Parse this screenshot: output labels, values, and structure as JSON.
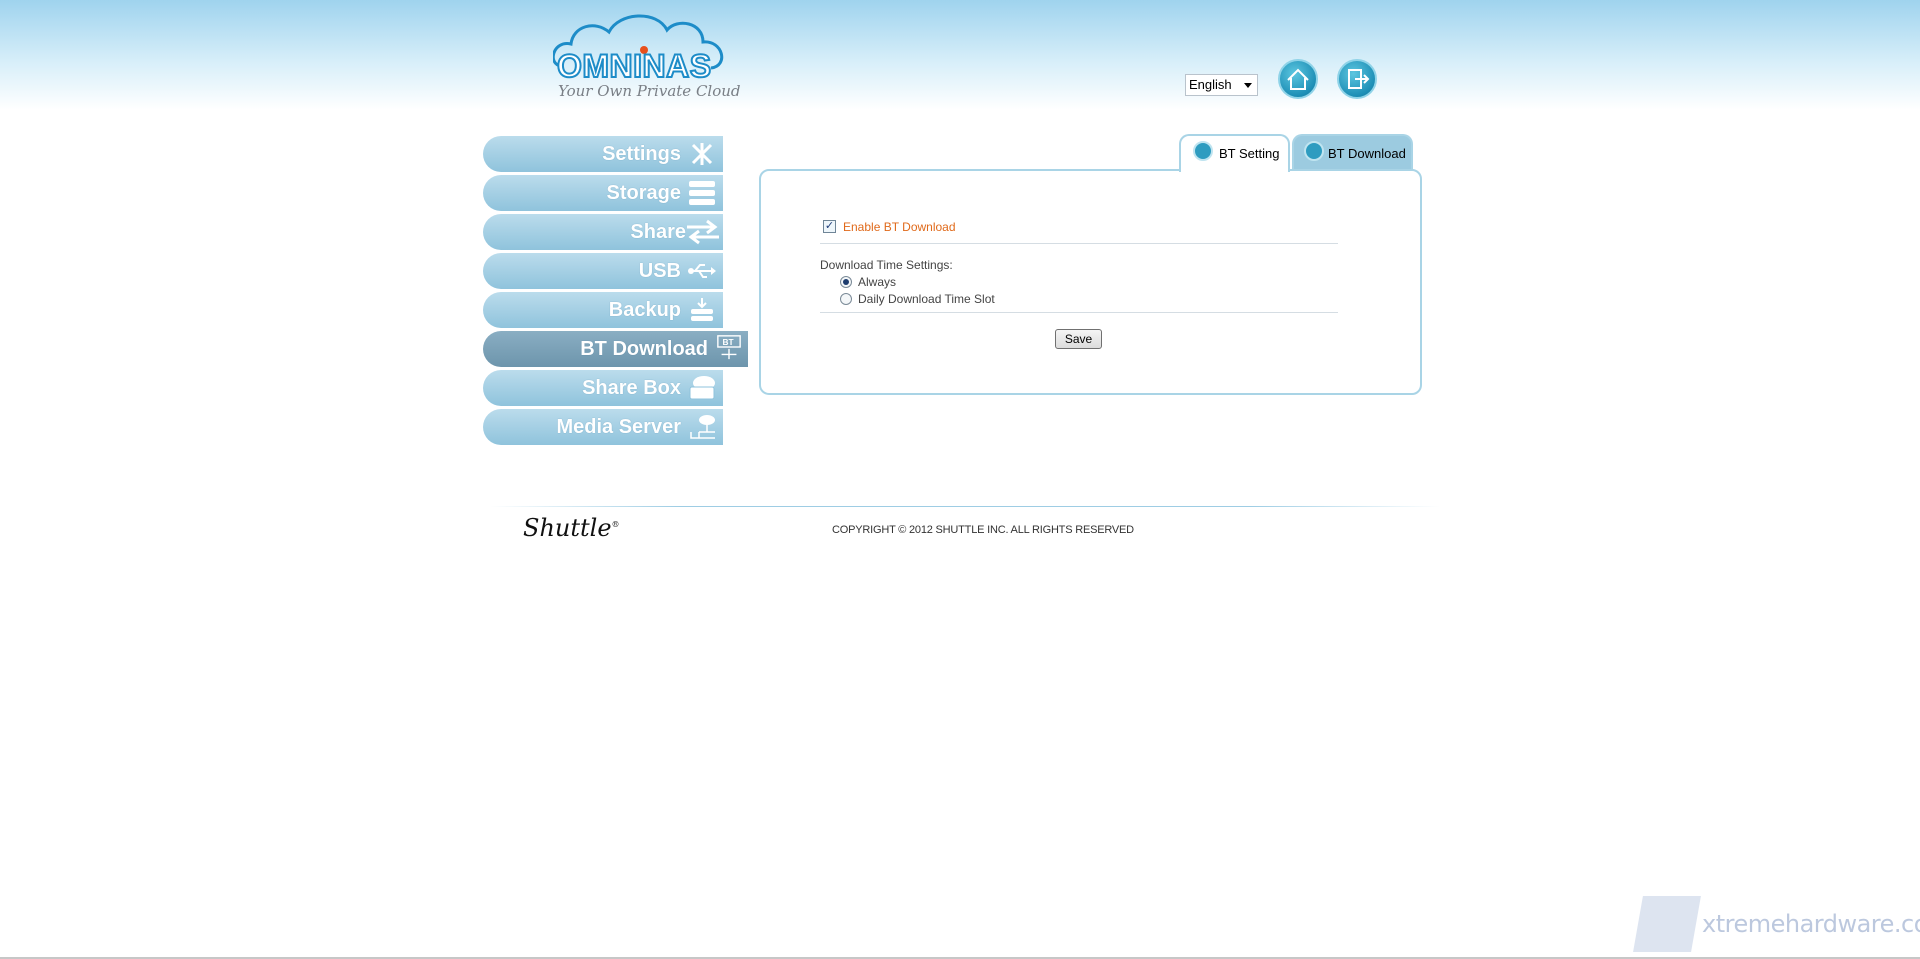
{
  "header": {
    "logo_name": "OMNINAS",
    "logo_tagline": "Your Own Private Cloud",
    "language": "English"
  },
  "sidebar": {
    "items": [
      {
        "label": "Settings"
      },
      {
        "label": "Storage"
      },
      {
        "label": "Share"
      },
      {
        "label": "USB"
      },
      {
        "label": "Backup"
      },
      {
        "label": "BT Download",
        "active": true
      },
      {
        "label": "Share Box"
      },
      {
        "label": "Media Server"
      }
    ]
  },
  "tabs": [
    {
      "label": "BT Setting",
      "active": true
    },
    {
      "label": "BT Download",
      "active": false
    }
  ],
  "form": {
    "enable_label": "Enable BT Download",
    "enable_checked": true,
    "time_settings_label": "Download Time Settings:",
    "options": [
      "Always",
      "Daily Download Time Slot"
    ],
    "selected_option": "Always",
    "save_label": "Save"
  },
  "footer": {
    "brand": "Shuttle",
    "copyright": "COPYRIGHT © 2012 SHUTTLE INC. ALL RIGHTS RESERVED"
  },
  "watermark": "xtremehardware.com",
  "colors": {
    "accent": "#1d8cc8",
    "nav": "#8fc3dc",
    "nav_active": "#6d95ac",
    "enable_label": "#e06a1b"
  }
}
